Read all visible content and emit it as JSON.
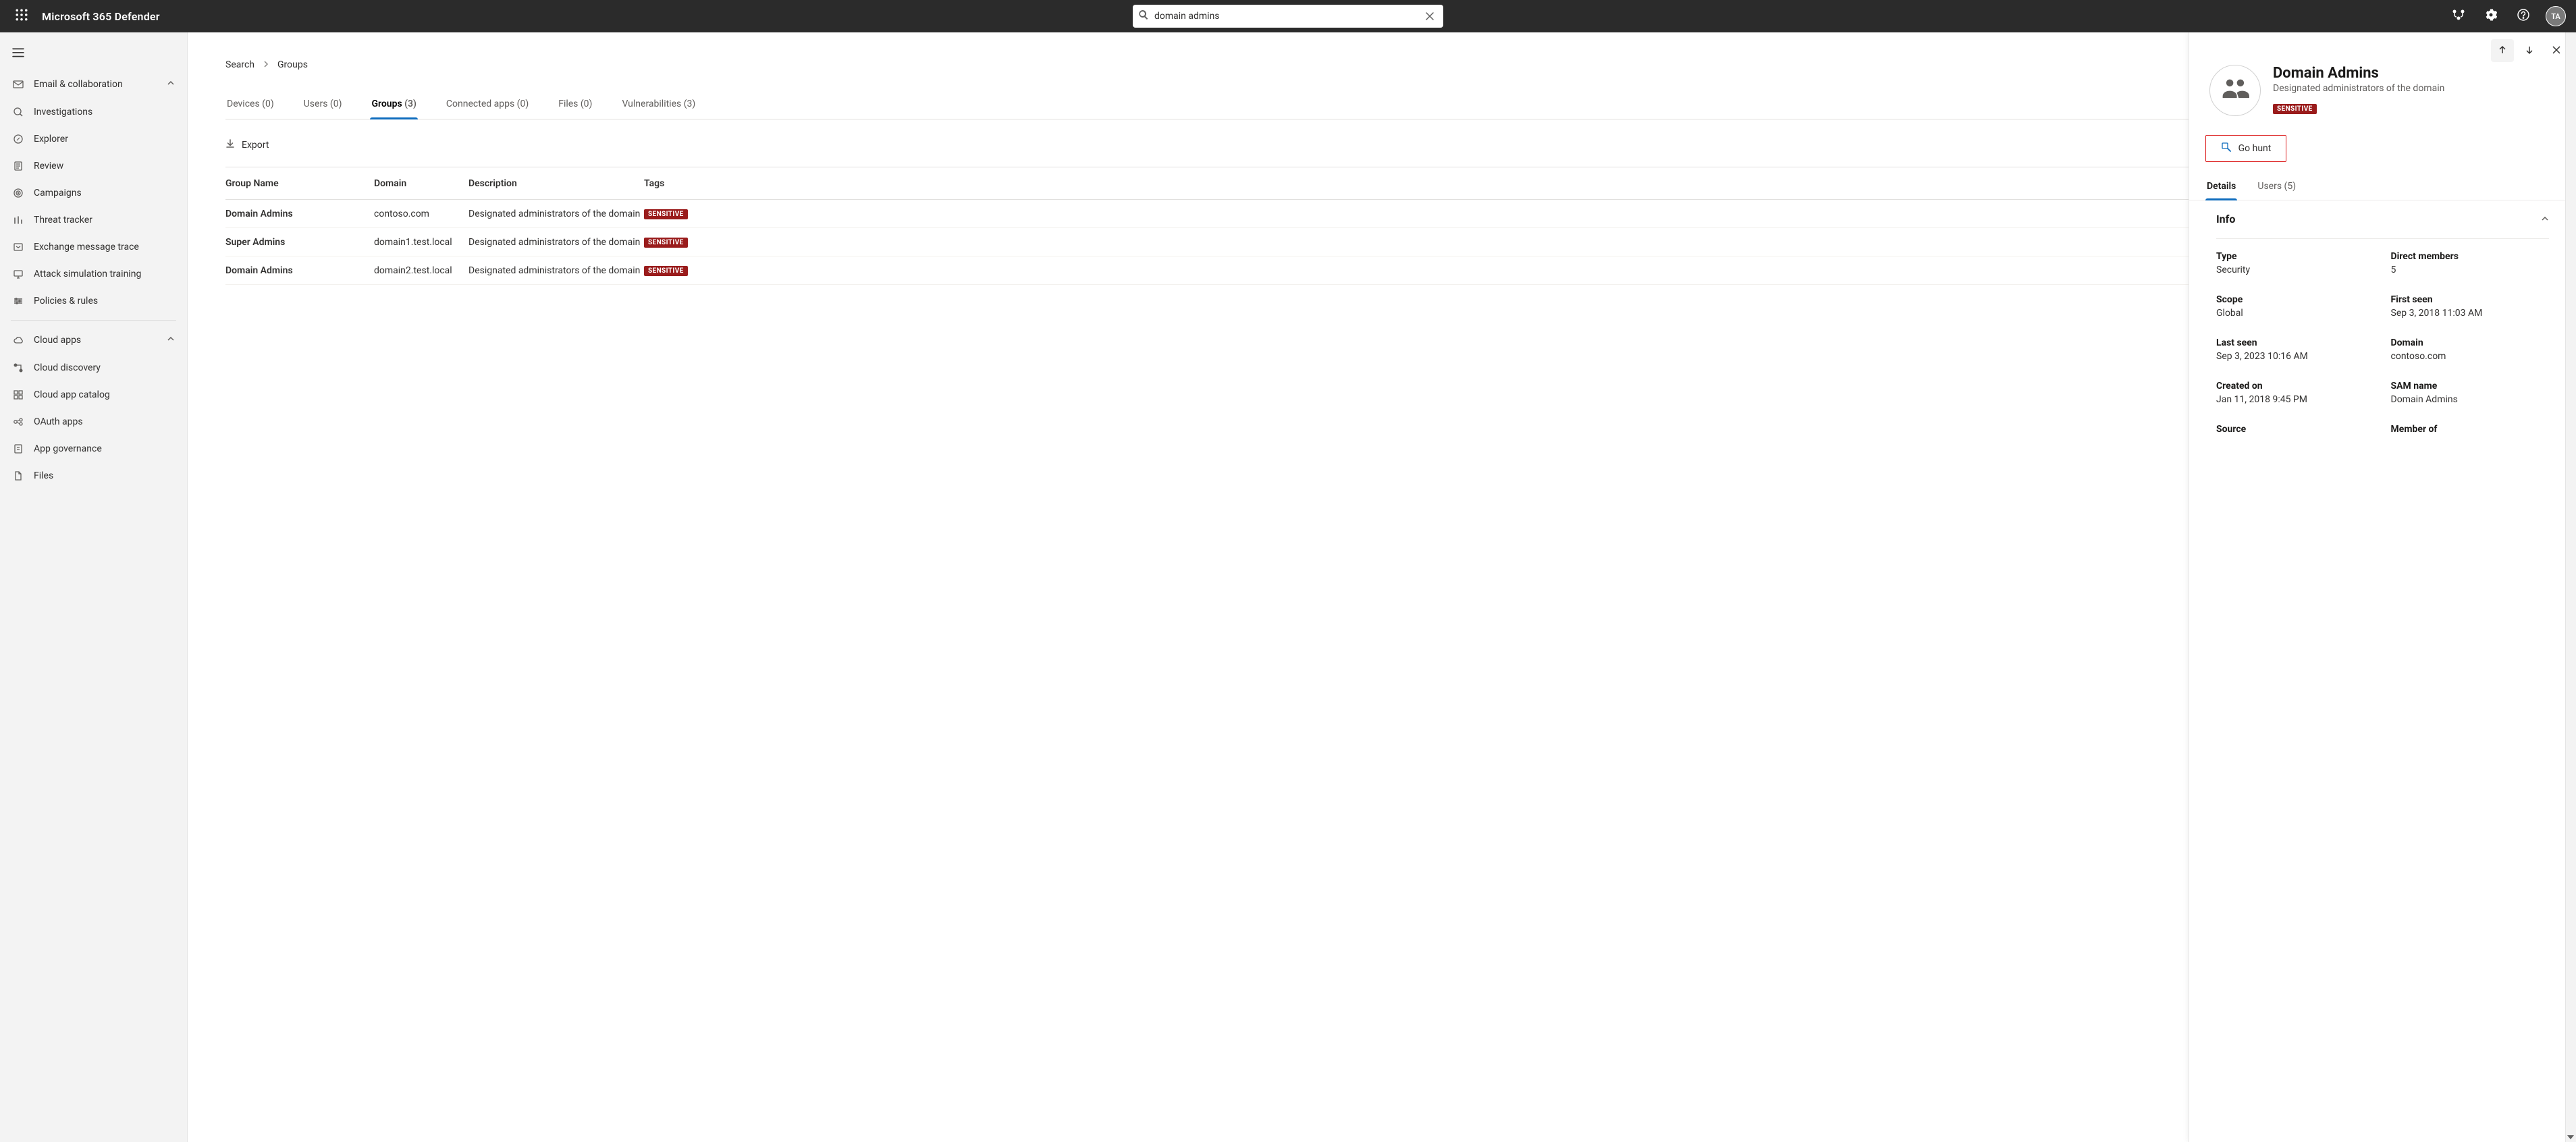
{
  "header": {
    "app_title": "Microsoft 365 Defender",
    "search_value": "domain admins",
    "avatar_initials": "TA"
  },
  "sidebar": {
    "group_email": {
      "label": "Email & collaboration",
      "items": [
        {
          "key": "investigations",
          "label": "Investigations"
        },
        {
          "key": "explorer",
          "label": "Explorer"
        },
        {
          "key": "review",
          "label": "Review"
        },
        {
          "key": "campaigns",
          "label": "Campaigns"
        },
        {
          "key": "threat-tracker",
          "label": "Threat tracker"
        },
        {
          "key": "exchange-trace",
          "label": "Exchange message trace"
        },
        {
          "key": "attack-sim",
          "label": "Attack simulation training"
        },
        {
          "key": "policies-rules",
          "label": "Policies & rules"
        }
      ]
    },
    "group_cloud": {
      "label": "Cloud apps",
      "items": [
        {
          "key": "cloud-discovery",
          "label": "Cloud discovery"
        },
        {
          "key": "cloud-catalog",
          "label": "Cloud app catalog"
        },
        {
          "key": "oauth-apps",
          "label": "OAuth apps"
        },
        {
          "key": "app-governance",
          "label": "App governance"
        },
        {
          "key": "files",
          "label": "Files"
        }
      ]
    }
  },
  "breadcrumb": {
    "root": "Search",
    "leaf": "Groups"
  },
  "tabs": [
    {
      "key": "devices",
      "label": "Devices",
      "count": 0
    },
    {
      "key": "users",
      "label": "Users",
      "count": 0
    },
    {
      "key": "groups",
      "label": "Groups",
      "count": 3,
      "active": true
    },
    {
      "key": "connected-apps",
      "label": "Connected apps",
      "count": 0
    },
    {
      "key": "files",
      "label": "Files",
      "count": 0
    },
    {
      "key": "vulnerabilities",
      "label": "Vulnerabilities",
      "count": 3
    }
  ],
  "export_label": "Export",
  "grid": {
    "columns": [
      "Group Name",
      "Domain",
      "Description",
      "Tags"
    ],
    "rows": [
      {
        "name": "Domain Admins",
        "domain": "contoso.com",
        "description": "Designated administrators of the domain",
        "tag": "SENSITIVE"
      },
      {
        "name": "Super Admins",
        "domain": "domain1.test.local",
        "description": "Designated administrators of the domain",
        "tag": "SENSITIVE"
      },
      {
        "name": "Domain Admins",
        "domain": "domain2.test.local",
        "description": "Designated administrators of the domain",
        "tag": "SENSITIVE"
      }
    ]
  },
  "panel": {
    "title": "Domain Admins",
    "subtitle": "Designated administrators of the domain",
    "badge": "SENSITIVE",
    "go_hunt_label": "Go hunt",
    "tabs": {
      "details": "Details",
      "users_label": "Users",
      "users_count": 5
    },
    "section_info": "Info",
    "info": {
      "type_label": "Type",
      "type_value": "Security",
      "members_label": "Direct members",
      "members_value": "5",
      "scope_label": "Scope",
      "scope_value": "Global",
      "firstseen_label": "First seen",
      "firstseen_value": "Sep 3, 2018 11:03 AM",
      "lastseen_label": "Last seen",
      "lastseen_value": "Sep 3, 2023 10:16 AM",
      "domain_label": "Domain",
      "domain_value": "contoso.com",
      "created_label": "Created on",
      "created_value": "Jan 11, 2018 9:45 PM",
      "sam_label": "SAM name",
      "sam_value": "Domain Admins",
      "source_label": "Source",
      "memberof_label": "Member of"
    }
  }
}
